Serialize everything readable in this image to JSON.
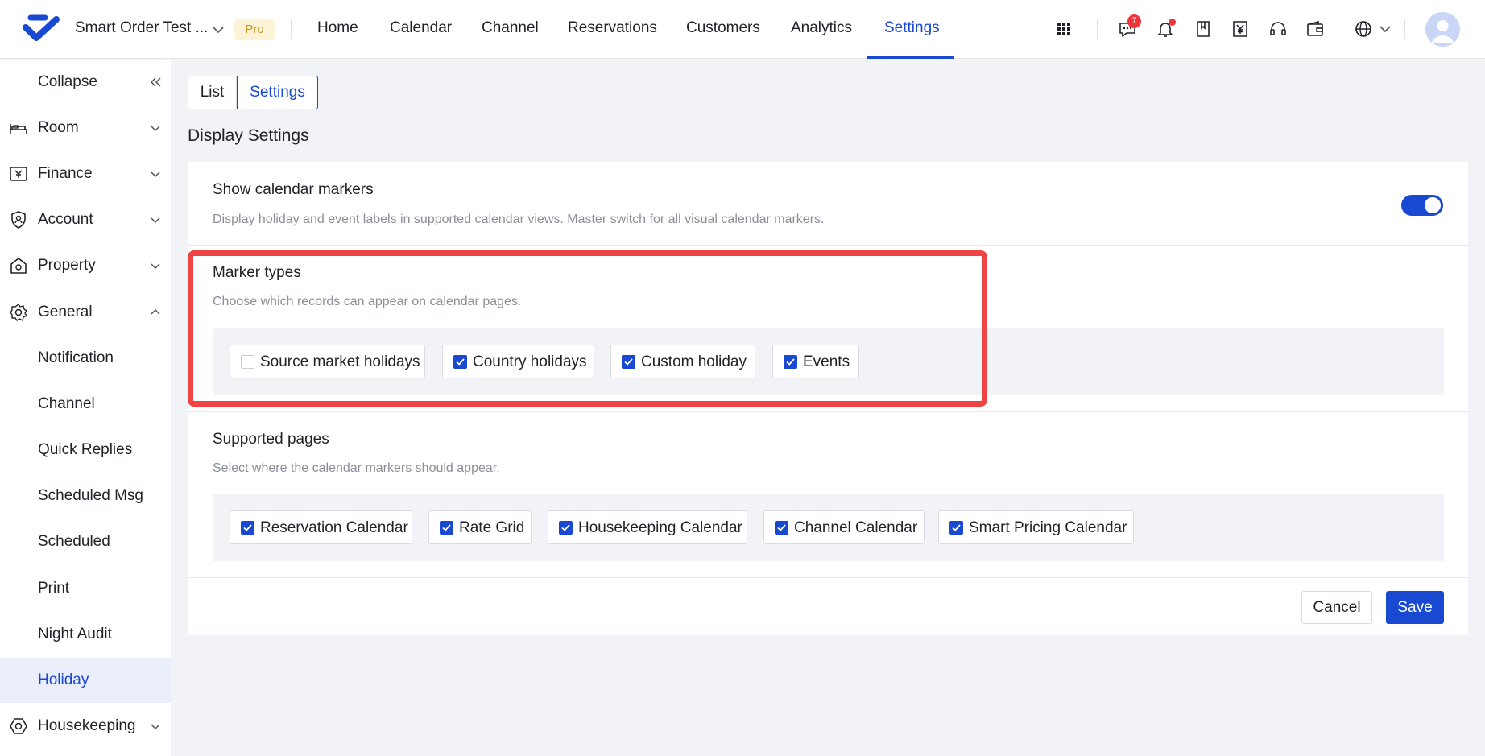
{
  "header": {
    "org_name": "Smart Order Test ...",
    "plan_badge": "Pro",
    "nav": [
      {
        "label": "Home"
      },
      {
        "label": "Calendar"
      },
      {
        "label": "Channel"
      },
      {
        "label": "Reservations"
      },
      {
        "label": "Customers"
      },
      {
        "label": "Analytics"
      },
      {
        "label": "Settings",
        "active": true
      }
    ],
    "message_count": "7",
    "icons": [
      "apps-grid-icon",
      "chat-icon",
      "bell-icon",
      "bookmark-icon",
      "yen-icon",
      "headset-icon",
      "wallet-icon",
      "globe-icon",
      "avatar"
    ]
  },
  "sidebar": {
    "collapse_label": "Collapse",
    "items": [
      {
        "label": "Room",
        "icon": "bed-icon"
      },
      {
        "label": "Finance",
        "icon": "finance-icon"
      },
      {
        "label": "Account",
        "icon": "account-shield-icon"
      },
      {
        "label": "Property",
        "icon": "property-icon"
      },
      {
        "label": "General",
        "icon": "gear-icon",
        "expanded": true
      },
      {
        "label": "Notification"
      },
      {
        "label": "Channel"
      },
      {
        "label": "Quick Replies"
      },
      {
        "label": "Scheduled Msg"
      },
      {
        "label": "Scheduled"
      },
      {
        "label": "Print"
      },
      {
        "label": "Night Audit"
      },
      {
        "label": "Holiday",
        "active": true
      },
      {
        "label": "Housekeeping",
        "icon": "housekeeping-icon"
      }
    ]
  },
  "main": {
    "tabs": [
      {
        "label": "List"
      },
      {
        "label": "Settings",
        "selected": true
      }
    ],
    "section_title": "Display Settings",
    "show_markers": {
      "title": "Show calendar markers",
      "description": "Display holiday and event labels in supported calendar views. Master switch for all visual calendar markers.",
      "enabled": true
    },
    "marker_types": {
      "title": "Marker types",
      "description": "Choose which records can appear on calendar pages.",
      "options": [
        {
          "label": "Source market holidays",
          "checked": false
        },
        {
          "label": "Country holidays",
          "checked": true
        },
        {
          "label": "Custom holiday",
          "checked": true
        },
        {
          "label": "Events",
          "checked": true
        }
      ]
    },
    "supported_pages": {
      "title": "Supported pages",
      "description": "Select where the calendar markers should appear.",
      "options": [
        {
          "label": "Reservation Calendar",
          "checked": true
        },
        {
          "label": "Rate Grid",
          "checked": true
        },
        {
          "label": "Housekeeping Calendar",
          "checked": true
        },
        {
          "label": "Channel Calendar",
          "checked": true
        },
        {
          "label": "Smart Pricing Calendar",
          "checked": true
        }
      ]
    },
    "buttons": {
      "cancel": "Cancel",
      "save": "Save"
    }
  },
  "colors": {
    "accent": "#1a49d1",
    "highlight": "#ef4444",
    "badge": "#f0353b"
  }
}
